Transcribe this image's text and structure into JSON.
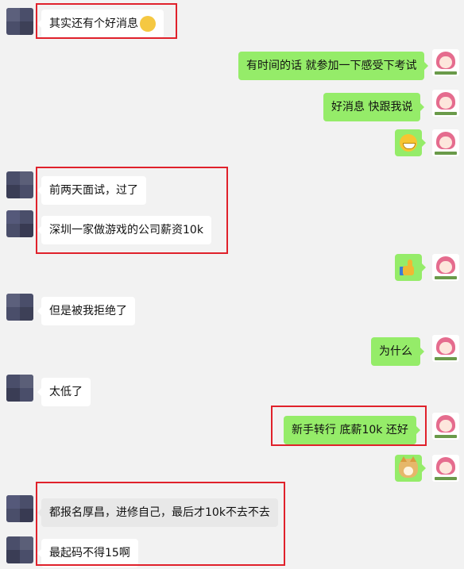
{
  "messages": [
    {
      "side": "left",
      "text": "其实还有个好消息"
    },
    {
      "side": "right",
      "text": "有时间的话 就参加一下感受下考试"
    },
    {
      "side": "right",
      "text": "好消息 快跟我说"
    },
    {
      "side": "right",
      "emoji": "grin-emoji"
    },
    {
      "side": "left",
      "text": "前两天面试，过了"
    },
    {
      "side": "left",
      "text": "深圳一家做游戏的公司薪资10k"
    },
    {
      "side": "right",
      "emoji": "thumbs-up-emoji"
    },
    {
      "side": "left",
      "text": "但是被我拒绝了"
    },
    {
      "side": "right",
      "text": "为什么"
    },
    {
      "side": "left",
      "text": "太低了"
    },
    {
      "side": "right",
      "text": "新手转行 底薪10k  还好"
    },
    {
      "side": "right",
      "emoji": "doge-emoji"
    },
    {
      "side": "left",
      "text": "都报名厚昌，进修自己，最后才10k不去不去"
    },
    {
      "side": "left",
      "text": "最起码不得15啊"
    }
  ],
  "colors": {
    "background": "#f2f2f2",
    "bubble_left": "#ffffff",
    "bubble_right": "#95ec69",
    "highlight_box": "#e0212b"
  }
}
